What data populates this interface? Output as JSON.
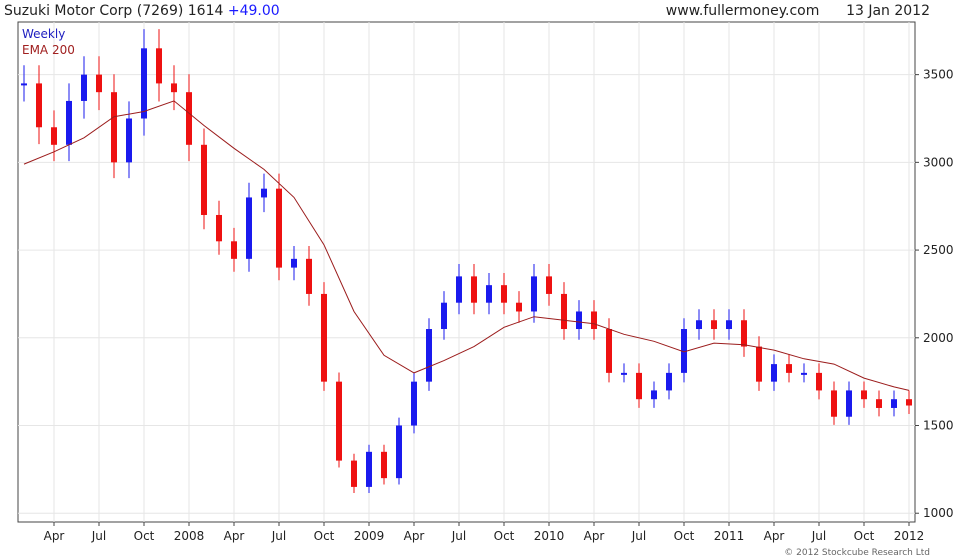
{
  "header": {
    "title": "Suzuki Motor Corp (7269) 1614",
    "change": "+49.00",
    "site": "www.fullermoney.com",
    "date": "13 Jan 2012"
  },
  "legend": {
    "weekly": "Weekly",
    "ema": "EMA 200"
  },
  "copyright": "© 2012 Stockcube Research Ltd",
  "colors": {
    "up": "#1a1aee",
    "down": "#ee1111",
    "ema": "#9b1c1c",
    "grid": "#e6e6e6",
    "axis": "#444444"
  },
  "chart_data": {
    "type": "line",
    "title": "Suzuki Motor Corp (7269) 1614",
    "series": [
      {
        "name": "Weekly",
        "style": "candlestick",
        "x": [
          "2007-02",
          "2007-03",
          "2007-04",
          "2007-05",
          "2007-06",
          "2007-07",
          "2007-08",
          "2007-09",
          "2007-10",
          "2007-11",
          "2007-12",
          "2008-01",
          "2008-02",
          "2008-03",
          "2008-04",
          "2008-05",
          "2008-06",
          "2008-07",
          "2008-08",
          "2008-09",
          "2008-10",
          "2008-11",
          "2008-12",
          "2009-01",
          "2009-02",
          "2009-03",
          "2009-04",
          "2009-05",
          "2009-06",
          "2009-07",
          "2009-08",
          "2009-09",
          "2009-10",
          "2009-11",
          "2009-12",
          "2010-01",
          "2010-02",
          "2010-03",
          "2010-04",
          "2010-05",
          "2010-06",
          "2010-07",
          "2010-08",
          "2010-09",
          "2010-10",
          "2010-11",
          "2010-12",
          "2011-01",
          "2011-02",
          "2011-03",
          "2011-04",
          "2011-05",
          "2011-06",
          "2011-07",
          "2011-08",
          "2011-09",
          "2011-10",
          "2011-11",
          "2011-12",
          "2012-01"
        ],
        "values": [
          3450,
          3200,
          3100,
          3350,
          3500,
          3400,
          3000,
          3250,
          3650,
          3450,
          3400,
          3100,
          2700,
          2550,
          2450,
          2800,
          2850,
          2400,
          2450,
          2250,
          1750,
          1300,
          1150,
          1350,
          1200,
          1500,
          1750,
          2050,
          2200,
          2350,
          2200,
          2300,
          2200,
          2150,
          2350,
          2250,
          2050,
          2150,
          2050,
          1800,
          1800,
          1650,
          1700,
          1800,
          2050,
          2100,
          2050,
          2100,
          1950,
          1750,
          1850,
          1800,
          1800,
          1700,
          1550,
          1700,
          1650,
          1600,
          1650,
          1614
        ]
      },
      {
        "name": "EMA 200",
        "x": [
          "2007-02",
          "2007-04",
          "2007-06",
          "2007-08",
          "2007-10",
          "2007-12",
          "2008-02",
          "2008-04",
          "2008-06",
          "2008-08",
          "2008-10",
          "2008-12",
          "2009-02",
          "2009-04",
          "2009-06",
          "2009-08",
          "2009-10",
          "2009-12",
          "2010-02",
          "2010-04",
          "2010-06",
          "2010-08",
          "2010-10",
          "2010-12",
          "2011-02",
          "2011-04",
          "2011-06",
          "2011-08",
          "2011-10",
          "2011-12",
          "2012-01"
        ],
        "values": [
          2990,
          3060,
          3140,
          3260,
          3290,
          3350,
          3210,
          3080,
          2960,
          2800,
          2530,
          2150,
          1900,
          1800,
          1870,
          1950,
          2060,
          2120,
          2100,
          2080,
          2020,
          1980,
          1920,
          1970,
          1960,
          1930,
          1880,
          1850,
          1770,
          1720,
          1700
        ]
      }
    ],
    "x_tick_labels": [
      "Apr",
      "Jul",
      "Oct",
      "2008",
      "Apr",
      "Jul",
      "Oct",
      "2009",
      "Apr",
      "Jul",
      "Oct",
      "2010",
      "Apr",
      "Jul",
      "Oct",
      "2011",
      "Apr",
      "Jul",
      "Oct",
      "2012"
    ],
    "y_tick_labels": [
      "1000",
      "1500",
      "2000",
      "2500",
      "3000",
      "3500"
    ],
    "ylim": [
      950,
      3800
    ],
    "xlim": [
      "2007-02",
      "2012-01"
    ],
    "grid": true,
    "legend_position": "top-left"
  }
}
